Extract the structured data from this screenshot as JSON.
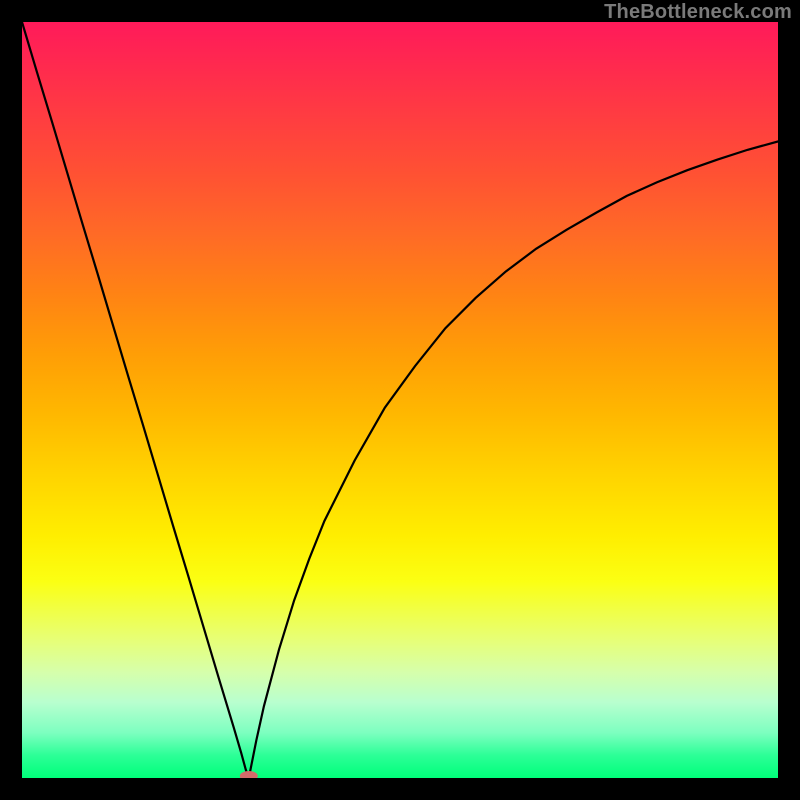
{
  "watermark": "TheBottleneck.com",
  "chart_data": {
    "type": "line",
    "title": "",
    "xlabel": "",
    "ylabel": "",
    "xlim": [
      0,
      100
    ],
    "ylim": [
      0,
      100
    ],
    "min_point": {
      "x": 30,
      "y": 0
    },
    "series": [
      {
        "name": "left-branch",
        "x": [
          0,
          2,
          4,
          6,
          8,
          10,
          12,
          14,
          16,
          18,
          20,
          22,
          24,
          26,
          28,
          29,
          29.6,
          30
        ],
        "y": [
          100,
          93.3,
          86.7,
          80,
          73.3,
          66.7,
          60,
          53.3,
          46.7,
          40,
          33.3,
          26.7,
          20,
          13.3,
          6.7,
          3.3,
          1.1,
          0
        ]
      },
      {
        "name": "right-branch",
        "x": [
          30,
          30.5,
          31,
          32,
          34,
          36,
          38,
          40,
          44,
          48,
          52,
          56,
          60,
          64,
          68,
          72,
          76,
          80,
          84,
          88,
          92,
          96,
          100
        ],
        "y": [
          0,
          2.5,
          5,
          9.5,
          17,
          23.5,
          29,
          34,
          42,
          49,
          54.5,
          59.5,
          63.5,
          67,
          70,
          72.5,
          74.8,
          77,
          78.8,
          80.4,
          81.8,
          83.1,
          84.2
        ]
      }
    ],
    "marker": {
      "x": 30,
      "y": 0,
      "color": "#d46a6a",
      "rx": 9,
      "ry": 5
    }
  }
}
